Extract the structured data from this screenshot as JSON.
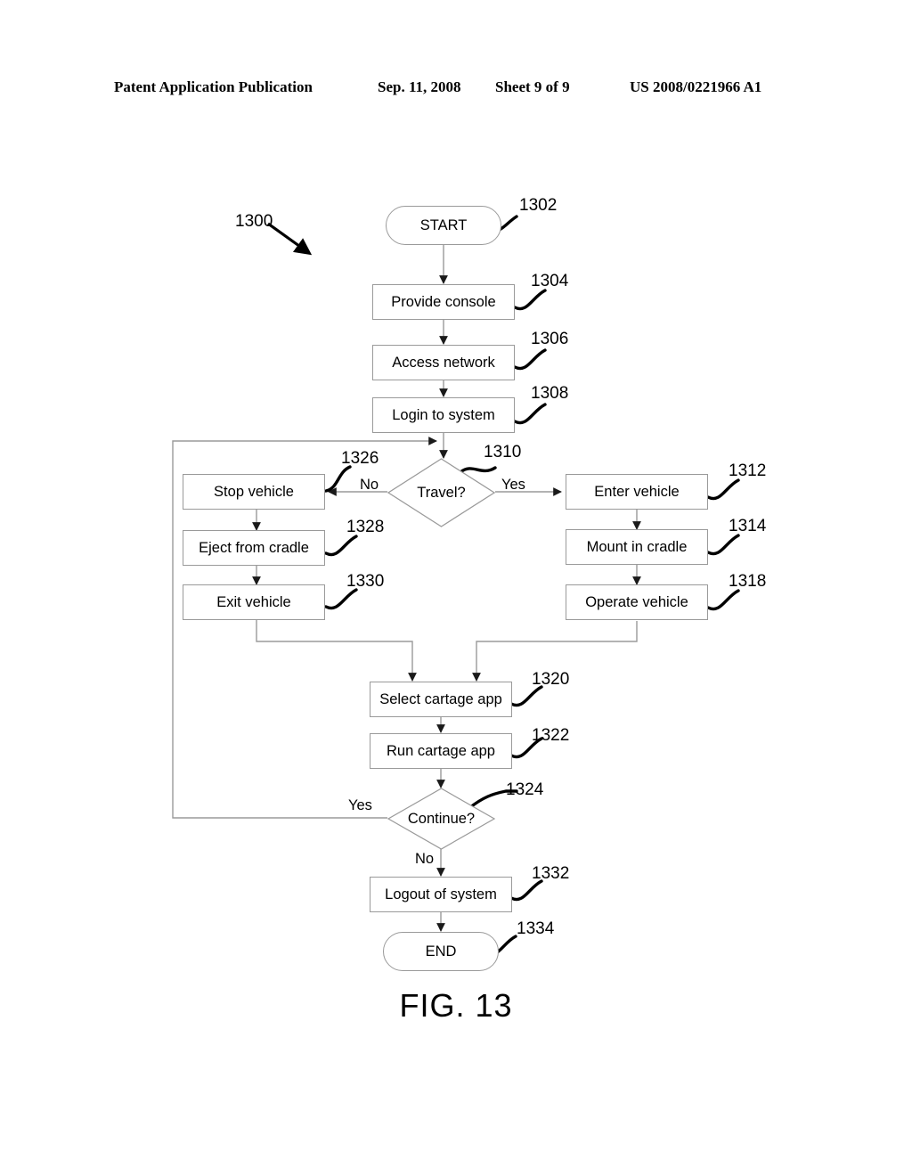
{
  "header": {
    "publication": "Patent Application Publication",
    "date": "Sep. 11, 2008",
    "sheet": "Sheet 9 of 9",
    "number": "US 2008/0221966 A1"
  },
  "figure": {
    "caption": "FIG. 13",
    "diagram_ref": "1300"
  },
  "nodes": {
    "start": {
      "label": "START",
      "ref": "1302"
    },
    "provide_console": {
      "label": "Provide console",
      "ref": "1304"
    },
    "access_network": {
      "label": "Access network",
      "ref": "1306"
    },
    "login": {
      "label": "Login to system",
      "ref": "1308"
    },
    "travel": {
      "label": "Travel?",
      "ref": "1310"
    },
    "enter_vehicle": {
      "label": "Enter vehicle",
      "ref": "1312"
    },
    "mount_in_cradle": {
      "label": "Mount in cradle",
      "ref": "1314"
    },
    "operate_vehicle": {
      "label": "Operate vehicle",
      "ref": "1318"
    },
    "stop_vehicle": {
      "label": "Stop vehicle",
      "ref": "1326"
    },
    "eject_from_cradle": {
      "label": "Eject from cradle",
      "ref": "1328"
    },
    "exit_vehicle": {
      "label": "Exit vehicle",
      "ref": "1330"
    },
    "select_cartage_app": {
      "label": "Select cartage app",
      "ref": "1320"
    },
    "run_cartage_app": {
      "label": "Run cartage app",
      "ref": "1322"
    },
    "continue": {
      "label": "Continue?",
      "ref": "1324"
    },
    "logout": {
      "label": "Logout of system",
      "ref": "1332"
    },
    "end": {
      "label": "END",
      "ref": "1334"
    }
  },
  "edge_labels": {
    "travel_no": "No",
    "travel_yes": "Yes",
    "continue_yes": "Yes",
    "continue_no": "No"
  },
  "colors": {
    "ink": "#000000",
    "node_stroke": "#9a9a9a",
    "wire": "#9a9a9a",
    "leader": "#000000",
    "background": "#ffffff"
  }
}
